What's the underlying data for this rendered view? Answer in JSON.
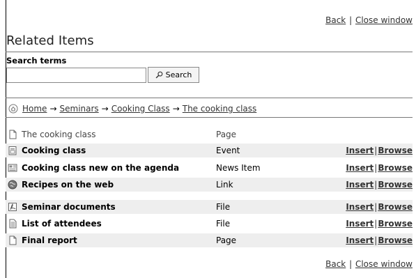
{
  "window_links": {
    "back": "Back",
    "separator": "|",
    "close": "Close window"
  },
  "page_title": "Related Items",
  "search": {
    "label": "Search terms",
    "value": "",
    "placeholder": "",
    "button": "Search"
  },
  "breadcrumb": {
    "arrow": "→",
    "items": [
      "Home",
      "Seminars",
      "Cooking Class",
      "The cooking class"
    ]
  },
  "current_item": {
    "name": "The cooking class",
    "type": "Page",
    "icon": "page-icon"
  },
  "items": [
    {
      "name": "Cooking class",
      "type": "Event",
      "icon": "event-icon",
      "insert": "Insert",
      "browse": "Browse"
    },
    {
      "name": "Cooking class new on the agenda",
      "type": "News Item",
      "icon": "news-item-icon",
      "insert": "Insert",
      "browse": "Browse"
    },
    {
      "name": "Recipes on the web",
      "type": "Link",
      "icon": "globe-link-icon",
      "insert": "Insert",
      "browse": "Browse"
    },
    {
      "name": "Seminar documents",
      "type": "File",
      "icon": "pdf-file-icon",
      "insert": "Insert",
      "browse": "Browse"
    },
    {
      "name": "List of attendees",
      "type": "File",
      "icon": "text-file-icon",
      "insert": "Insert",
      "browse": "Browse"
    },
    {
      "name": "Final report",
      "type": "Page",
      "icon": "page-icon",
      "insert": "Insert",
      "browse": "Browse"
    }
  ]
}
